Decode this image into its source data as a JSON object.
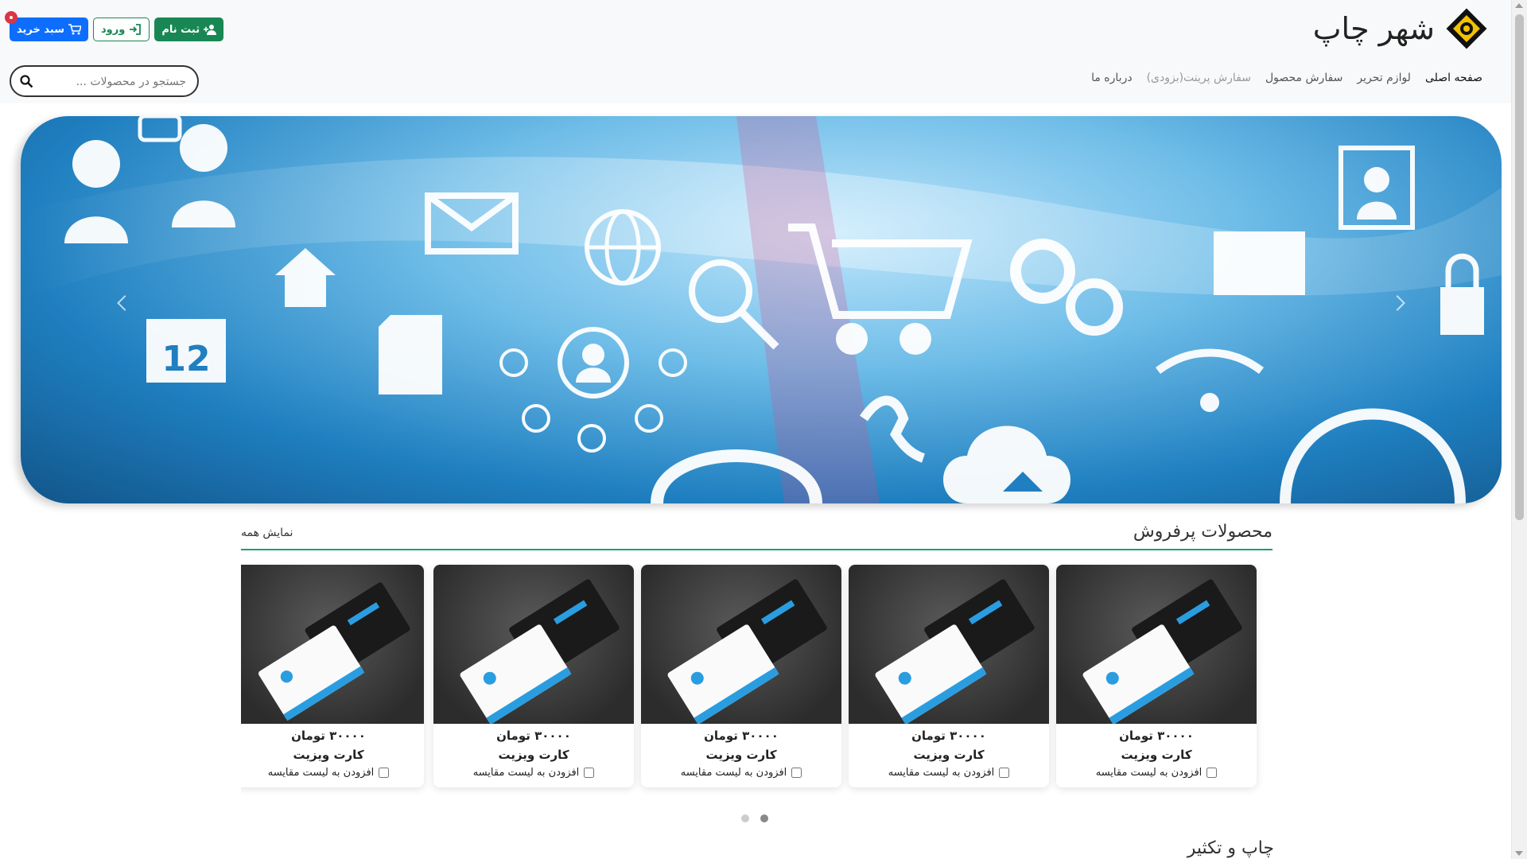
{
  "brand": {
    "name": "شهر چاپ",
    "logo_icon": "brand-logo-icon"
  },
  "auth": {
    "register_label": "ثبت نام",
    "login_label": "ورود",
    "cart_label": "سبد خرید"
  },
  "nav": {
    "items": [
      {
        "label": "صفحه اصلی"
      },
      {
        "label": "لوازم تحریر"
      },
      {
        "label": "سفارش محصول"
      },
      {
        "label": "سفارش پرینت(بزودی)"
      },
      {
        "label": "درباره ما"
      }
    ]
  },
  "search": {
    "placeholder": "جستجو در محصولات ..."
  },
  "best_sellers": {
    "title": "محصولات پرفروش",
    "show_all": "نمایش همه",
    "products": [
      {
        "price": "۳۰۰۰۰ تومان",
        "name": "کارت ویزیت",
        "compare": "افزودن به لیست مقایسه"
      },
      {
        "price": "۳۰۰۰۰ تومان",
        "name": "کارت ویزیت",
        "compare": "افزودن به لیست مقایسه"
      },
      {
        "price": "۳۰۰۰۰ تومان",
        "name": "کارت ویزیت",
        "compare": "افزودن به لیست مقایسه"
      },
      {
        "price": "۳۰۰۰۰ تومان",
        "name": "کارت ویزیت",
        "compare": "افزودن به لیست مقایسه"
      },
      {
        "price": "۳۰۰۰۰ تومان",
        "name": "کارت ویزیت",
        "compare": "افزودن به لیست مقایسه"
      }
    ]
  },
  "section2": {
    "title": "چاپ و تکثیر"
  },
  "hero": {
    "calendar_day": "12"
  },
  "colors": {
    "green": "#198754",
    "blue": "#0d6efd",
    "accent_line": "#1b9e77"
  }
}
